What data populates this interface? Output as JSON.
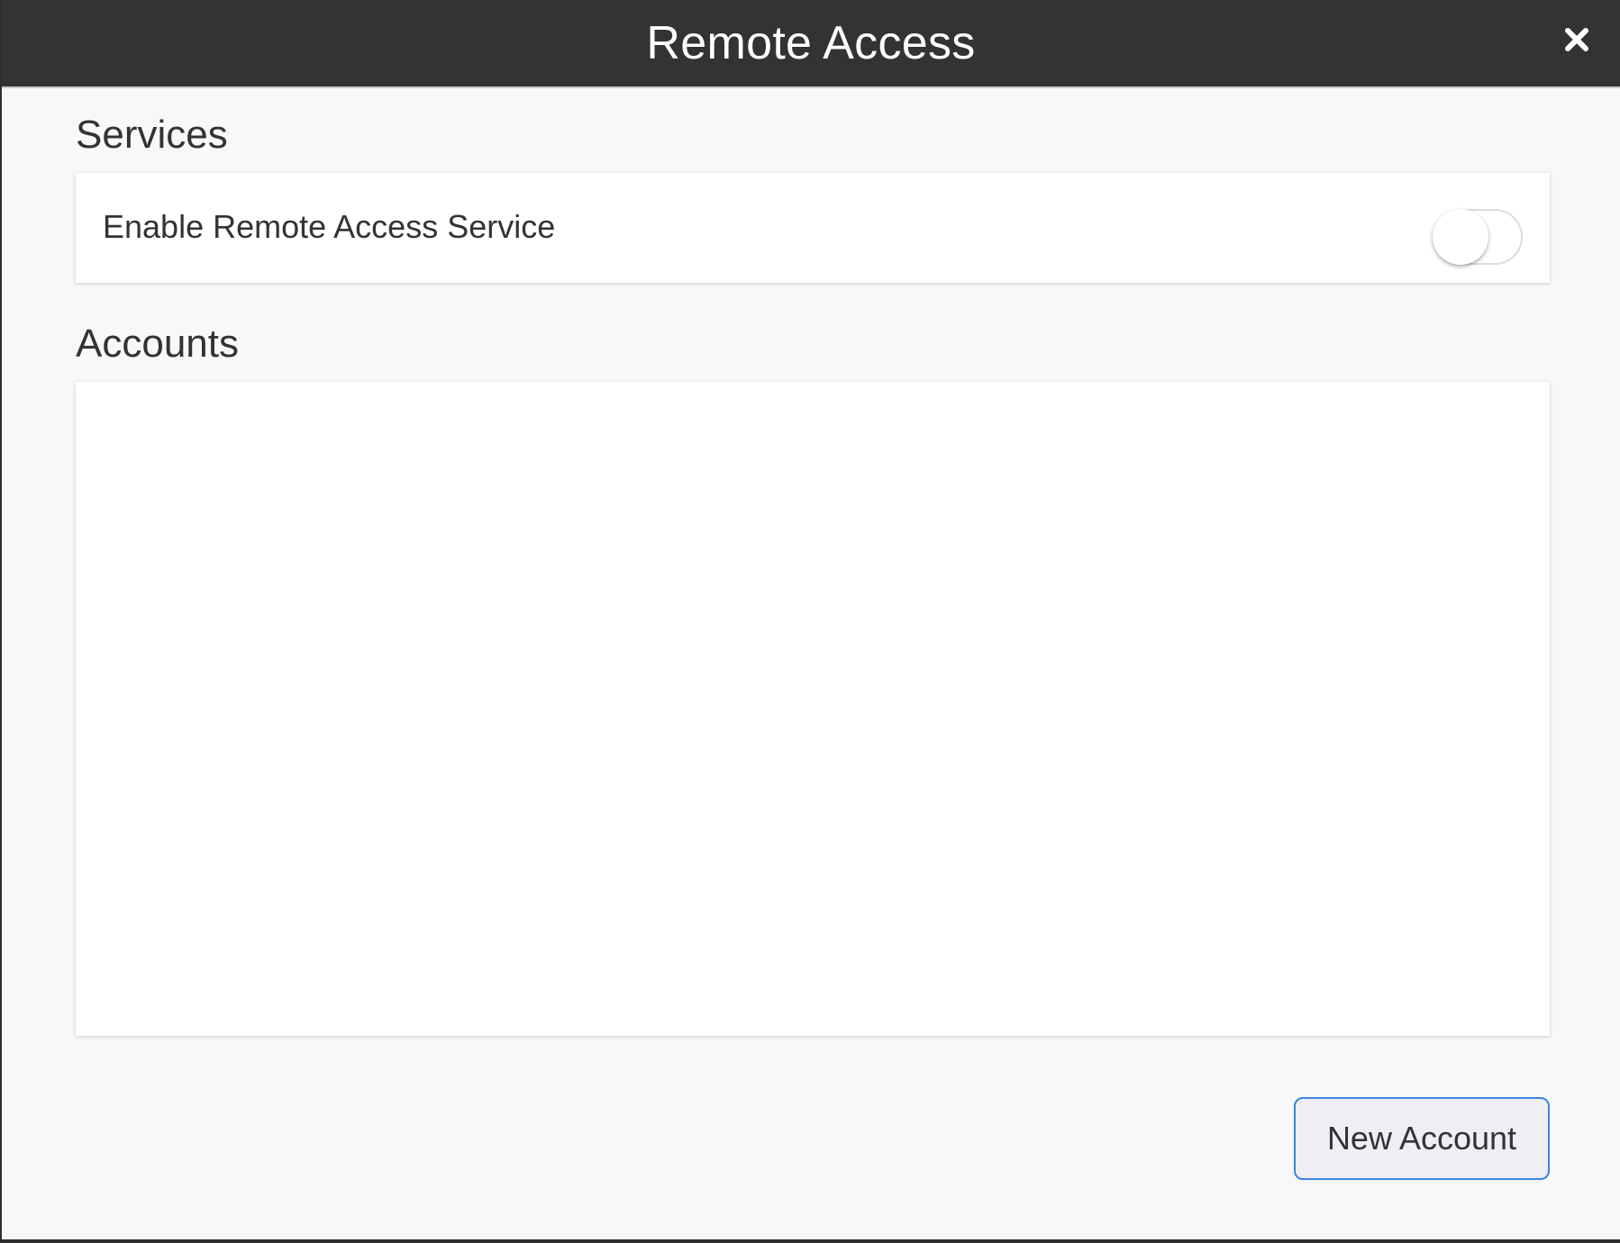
{
  "window": {
    "title": "Remote Access",
    "close_icon": "close-icon"
  },
  "services": {
    "heading": "Services",
    "items": [
      {
        "label": "Enable Remote Access Service",
        "enabled": false
      }
    ]
  },
  "accounts": {
    "heading": "Accounts",
    "items": []
  },
  "actions": {
    "new_account_label": "New Account"
  },
  "colors": {
    "titlebar": "#333333",
    "background": "#f7f8fa",
    "button_border": "#3a86e0"
  }
}
